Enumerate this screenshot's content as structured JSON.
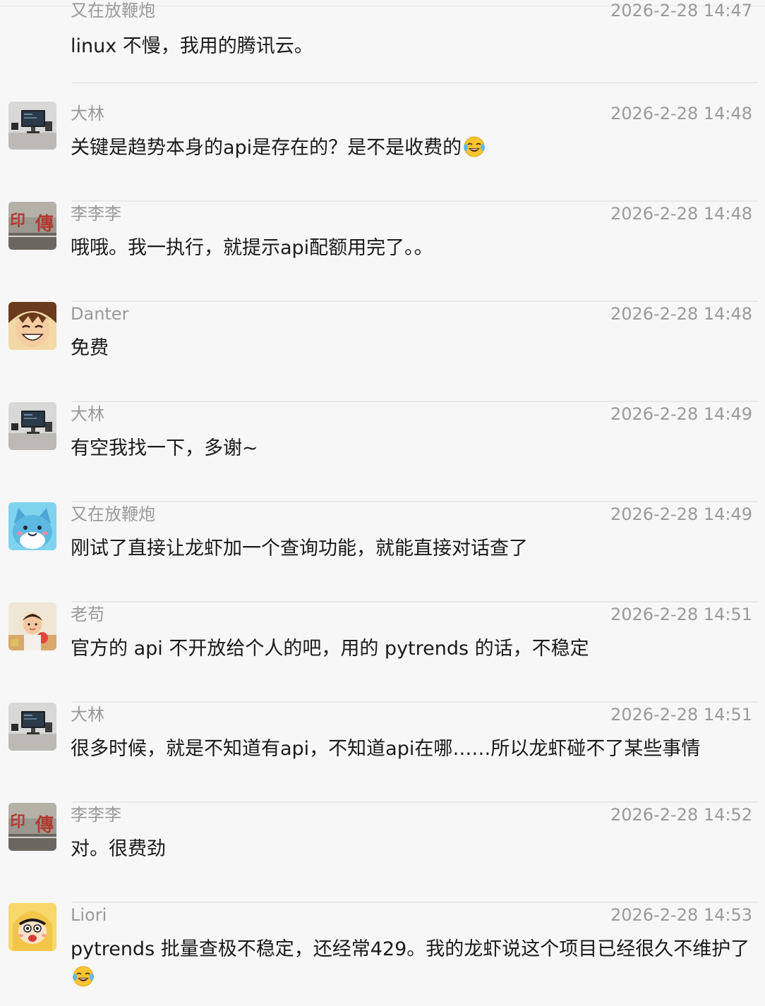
{
  "messages": [
    {
      "sender": "又在放鞭炮",
      "time": "2026-2-28 14:47",
      "text": "linux 不慢，我用的腾讯云。",
      "emoji": "",
      "avatar": "none"
    },
    {
      "sender": "大林",
      "time": "2026-2-28 14:48",
      "text": "关键是趋势本身的api是存在的？是不是收费的",
      "emoji": "face-with-tears-of-joy",
      "avatar": "desk-photo"
    },
    {
      "sender": "李李李",
      "time": "2026-2-28 14:48",
      "text": "哦哦。我一执行，就提示api配额用完了。。",
      "emoji": "",
      "avatar": "calligraphy-photo"
    },
    {
      "sender": "Danter",
      "time": "2026-2-28 14:48",
      "text": "免费",
      "emoji": "",
      "avatar": "anime-boy"
    },
    {
      "sender": "大林",
      "time": "2026-2-28 14:49",
      "text": "有空我找一下，多谢~",
      "emoji": "",
      "avatar": "desk-photo"
    },
    {
      "sender": "又在放鞭炮",
      "time": "2026-2-28 14:49",
      "text": "刚试了直接让龙虾加一个查询功能，就能直接对话查了",
      "emoji": "",
      "avatar": "blue-cat"
    },
    {
      "sender": "老苟",
      "time": "2026-2-28 14:51",
      "text": "官方的 api 不开放给个人的吧，用的 pytrends 的话，不稳定",
      "emoji": "",
      "avatar": "child-photo"
    },
    {
      "sender": "大林",
      "time": "2026-2-28 14:51",
      "text": "很多时候，就是不知道有api，不知道api在哪……所以龙虾碰不了某些事情",
      "emoji": "",
      "avatar": "desk-photo"
    },
    {
      "sender": "李李李",
      "time": "2026-2-28 14:52",
      "text": "对。很费劲",
      "emoji": "",
      "avatar": "calligraphy-photo"
    },
    {
      "sender": "Liori",
      "time": "2026-2-28 14:53",
      "text": "pytrends 批量查极不稳定，还经常429。我的龙虾说这个项目已经很久不维护了",
      "emoji": "face-with-tears-of-joy",
      "avatar": "crayon-kid"
    }
  ],
  "colors": {
    "background": "#f7f7f7",
    "name": "#9a9a9a",
    "text": "#1a1a1a",
    "divider": "#e8e8e8"
  }
}
